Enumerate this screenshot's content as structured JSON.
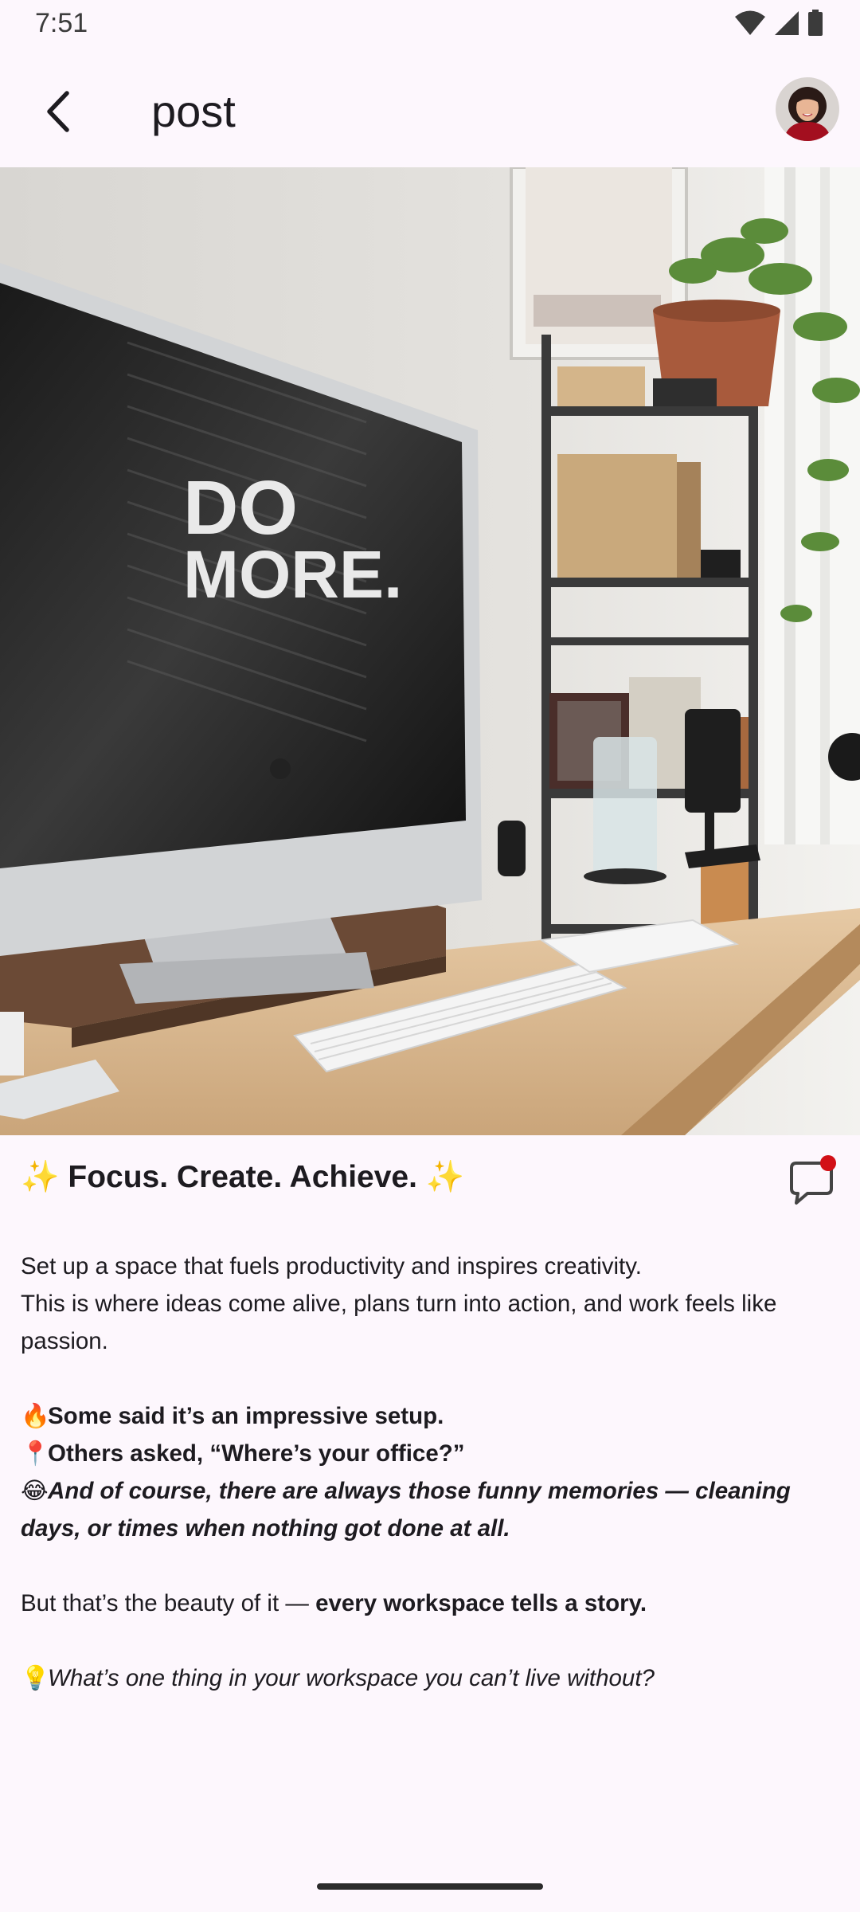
{
  "status_bar": {
    "time": "7:51",
    "icons": [
      "wifi-icon",
      "signal-icon",
      "battery-icon"
    ]
  },
  "app_bar": {
    "title": "post",
    "back_icon": "arrow-back-icon",
    "avatar": "user-avatar"
  },
  "post": {
    "image_text": "DO\nMORE.",
    "title": "✨ Focus. Create. Achieve. ✨",
    "comment_icon": "comment-icon",
    "notification_dot_color": "#d20f16",
    "paragraph1_line1": "Set up a space that fuels productivity and inspires creativity.",
    "paragraph1_line2": "This is where ideas come alive, plans turn into action, and work feels like passion.",
    "fire_emoji": "🔥",
    "line_impressive": "Some said it’s an impressive setup.",
    "pin_emoji": "📍",
    "line_office": "Others asked, “Where’s your office?”",
    "laugh_emoji": "😂",
    "line_memories": "And of course, there are always those funny memories — cleaning days, or times when nothing got done at all.",
    "beauty_prefix": "But that’s the beauty of it — ",
    "beauty_bold": "every workspace tells a story.",
    "bulb_emoji": "💡",
    "question": "What’s one thing in your workspace you can’t live without?"
  },
  "colors": {
    "background": "#fdf7fd",
    "text": "#1d1b20",
    "accent_red": "#d20f16"
  }
}
